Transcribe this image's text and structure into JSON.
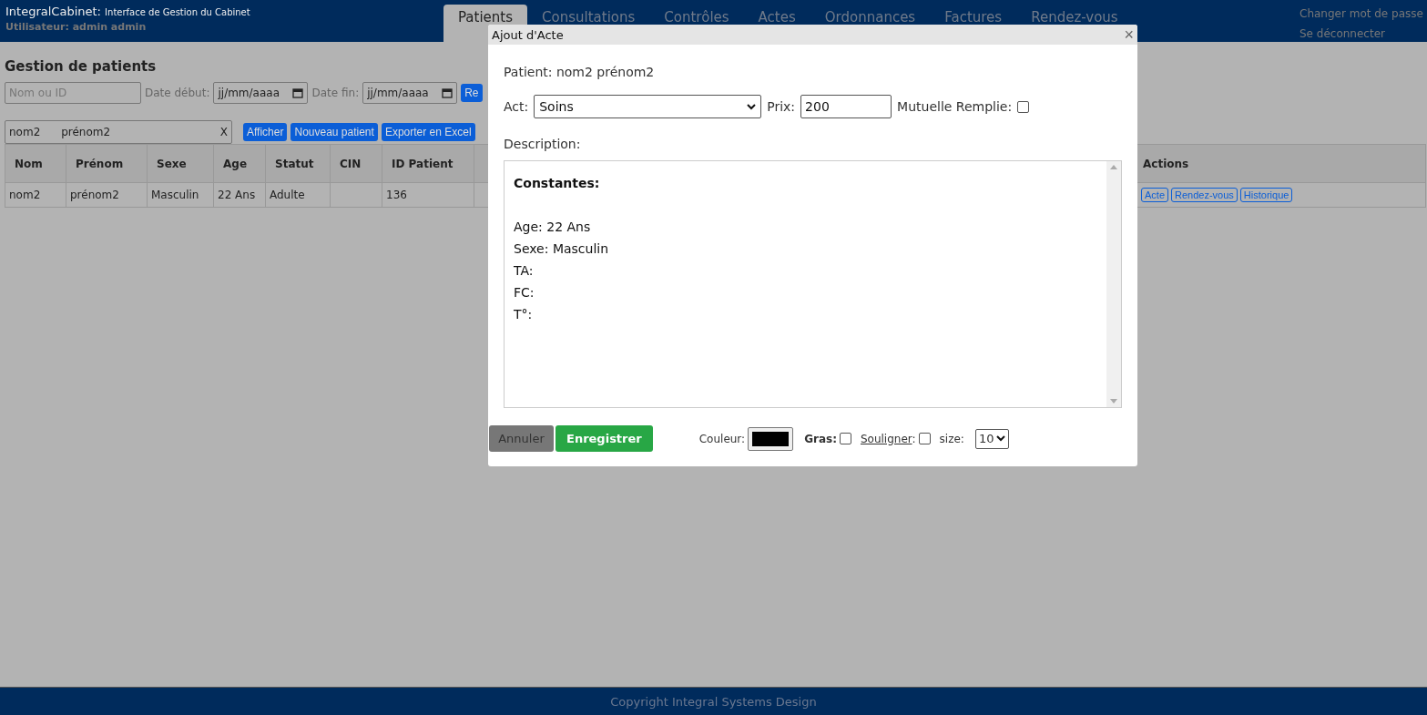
{
  "header": {
    "app_name": "IntegralCabinet:",
    "subtitle": "Interface de Gestion du Cabinet",
    "user": "Utilisateur: admin admin",
    "tabs": [
      {
        "label": "Patients",
        "selected": true
      },
      {
        "label": "Consultations",
        "selected": false
      },
      {
        "label": "Contrôles",
        "selected": false
      },
      {
        "label": "Actes",
        "selected": false
      },
      {
        "label": "Ordonnances",
        "selected": false
      },
      {
        "label": "Factures",
        "selected": false
      },
      {
        "label": "Rendez-vous",
        "selected": false
      }
    ],
    "links": [
      "Changer mot de passe",
      "Se déconnecter"
    ]
  },
  "page_title": "Gestion de patients",
  "filters": {
    "name_placeholder": "Nom ou ID",
    "start_label": "Date début:",
    "start_placeholder": "jj/mm/aaaa",
    "end_label": "Date fin:",
    "end_placeholder": "jj/mm/aaaa",
    "button": "Re"
  },
  "search": {
    "value": "nom2      prénom2",
    "clear": "X",
    "buttons": [
      "Afficher",
      "Nouveau patient",
      "Exporter en Excel"
    ]
  },
  "table": {
    "columns": [
      "Nom",
      "Prénom",
      "Sexe",
      "Age",
      "Statut",
      "CIN",
      "ID Patient",
      "Actions"
    ],
    "rows": [
      {
        "cells": [
          "nom2",
          "prénom2",
          "Masculin",
          "22 Ans",
          "Adulte",
          "",
          "136"
        ],
        "actions": [
          "Acte",
          "Rendez-vous",
          "Historique"
        ]
      }
    ]
  },
  "dialog": {
    "title": "Ajout d'Acte",
    "close": "×",
    "patient": "Patient: nom2 prénom2",
    "act_label": "Act:",
    "act_value": "Soins",
    "price_label": "Prix:",
    "price_value": "200",
    "mutual_label": "Mutuelle Remplie:",
    "mutual_checked": false,
    "description_label": "Description:",
    "description_heading": "Constantes:",
    "description_lines": [
      "Age: 22 Ans",
      "Sexe: Masculin",
      "TA:",
      "FC:",
      "T°:"
    ],
    "cancel": "Annuler",
    "save": "Enregistrer",
    "color_label": "Couleur:",
    "color": "#000000",
    "bold_label": "Gras:",
    "bold_checked": false,
    "underline_label": "Souligner",
    "underline_colon": ":",
    "underline_checked": false,
    "size_label": "size:",
    "size_value": "10"
  },
  "footer": "Copyright Integral Systems Design"
}
